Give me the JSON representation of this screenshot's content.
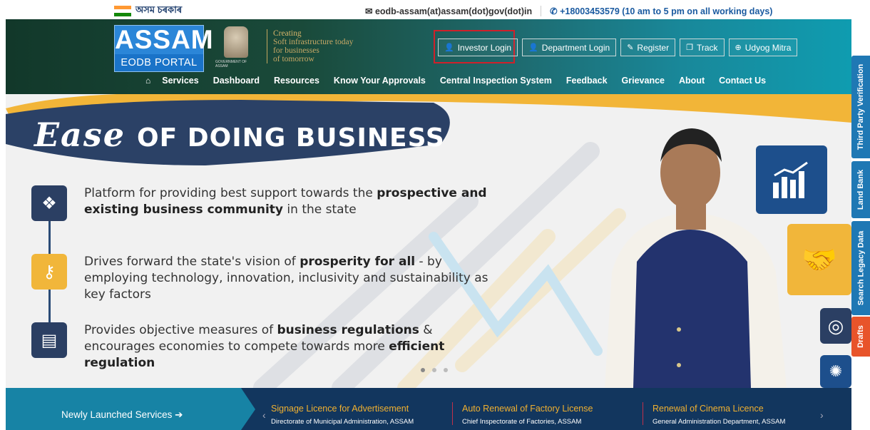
{
  "topbar": {
    "gov_label": "অসম চৰকাৰ",
    "email": "eodb-assam(at)assam(dot)gov(dot)in",
    "phone": "+18003453579 (10 am to 5 pm on all working days)"
  },
  "header": {
    "logo_big": "ASSAM",
    "logo_small": "EODB PORTAL",
    "emblem_text": "GOVERNMENT OF ASSAM",
    "tagline": [
      "Creating",
      "Soft infrastructure today",
      "for businesses",
      "of tomorrow"
    ],
    "buttons": {
      "investor": "Investor Login",
      "department": "Department Login",
      "register": "Register",
      "track": "Track",
      "udyog": "Udyog Mitra"
    },
    "nav": [
      "Services",
      "Dashboard",
      "Resources",
      "Know Your Approvals",
      "Central Inspection System",
      "Feedback",
      "Grievance",
      "About",
      "Contact Us"
    ]
  },
  "banner": {
    "ease": "Ease",
    "of_doing_business": "OF DOING BUSINESS",
    "points": [
      {
        "pre": "Platform for providing best support towards the ",
        "b1": "prospective and existing business community",
        "post": " in the state"
      },
      {
        "pre": "Drives forward the state's vision of ",
        "b1": "prosperity for all",
        "post": " - by employing technology, innovation, inclusivity and sustainability as key factors"
      },
      {
        "pre": "Provides objective measures of ",
        "b1": "business regulations",
        "mid": " & encourages economies to compete towards more ",
        "b2": "efficient regulation",
        "post": ""
      }
    ],
    "carousel_active": 0
  },
  "side_tabs": [
    "Third Party Verification",
    "Land Bank",
    "Search Legacy Data",
    "Drafts"
  ],
  "bottom": {
    "newly_label": "Newly Launched Services",
    "items": [
      {
        "title": "Signage Licence for Advertisement",
        "dept": "Directorate of Municipal Administration, ASSAM"
      },
      {
        "title": "Auto Renewal of Factory License",
        "dept": "Chief Inspectorate of Factories, ASSAM"
      },
      {
        "title": "Renewal of Cinema Licence",
        "dept": "General Administration Department, ASSAM"
      }
    ]
  },
  "colors": {
    "accent_gold": "#f1b63a",
    "navy": "#2b3f63",
    "highlight_red": "#d0202a",
    "drafts_orange": "#e8542a",
    "sidetab_blue": "#1f78b4"
  },
  "icons": [
    "flag-icon",
    "mail-icon",
    "phone-icon",
    "user-icon",
    "pencil-icon",
    "track-icon",
    "globe-icon",
    "home-icon",
    "network-icon",
    "keys-icon",
    "document-icon",
    "bar-chart-icon",
    "handshake-icon",
    "target-icon",
    "bulb-icon",
    "arrow-circle-right-icon",
    "chevron-left-icon",
    "chevron-right-icon"
  ]
}
